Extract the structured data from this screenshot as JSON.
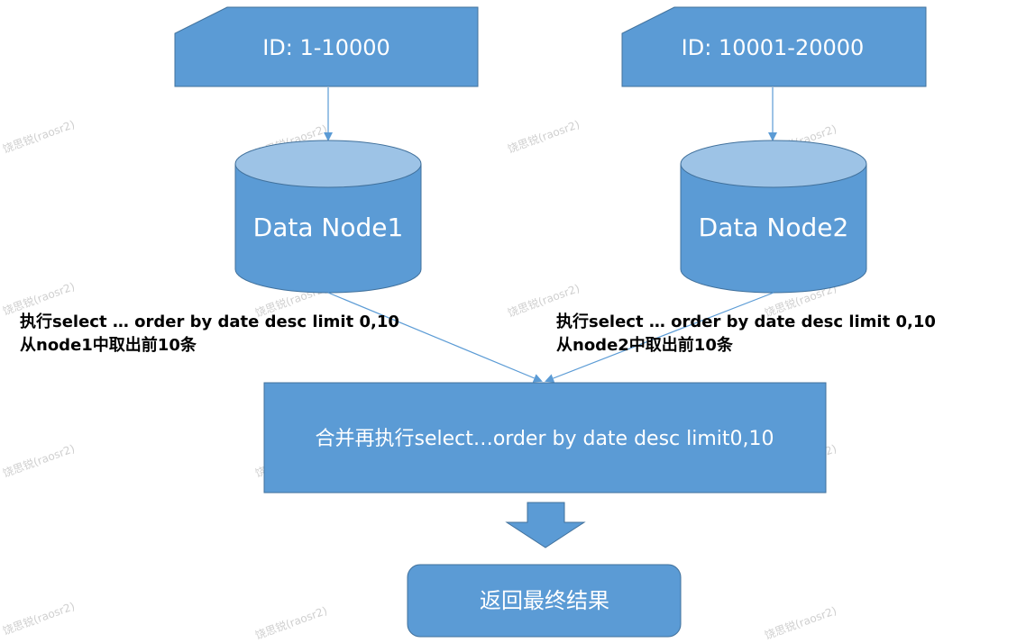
{
  "colors": {
    "fill": "#5B9BD5",
    "fill_light": "#9DC3E6",
    "stroke": "#41719C",
    "arrow": "#5B9BD5",
    "note_text": "#000000",
    "shape_text": "#FFFFFF",
    "watermark": "#CFCFCF"
  },
  "id_cards": [
    {
      "label": "ID: 1-10000"
    },
    {
      "label": "ID: 10001-20000"
    }
  ],
  "data_nodes": [
    {
      "label": "Data Node1"
    },
    {
      "label": "Data Node2"
    }
  ],
  "notes": [
    {
      "line1": "执行select … order by date desc limit 0,10",
      "line2": "从node1中取出前10条"
    },
    {
      "line1": "执行select … order by date desc limit 0,10",
      "line2": "从node2中取出前10条"
    }
  ],
  "merge_box": {
    "label": "合并再执行select…order by date desc limit0,10"
  },
  "result_box": {
    "label": "返回最终结果"
  },
  "watermark": {
    "text": "饶思锐(raosr2)"
  }
}
